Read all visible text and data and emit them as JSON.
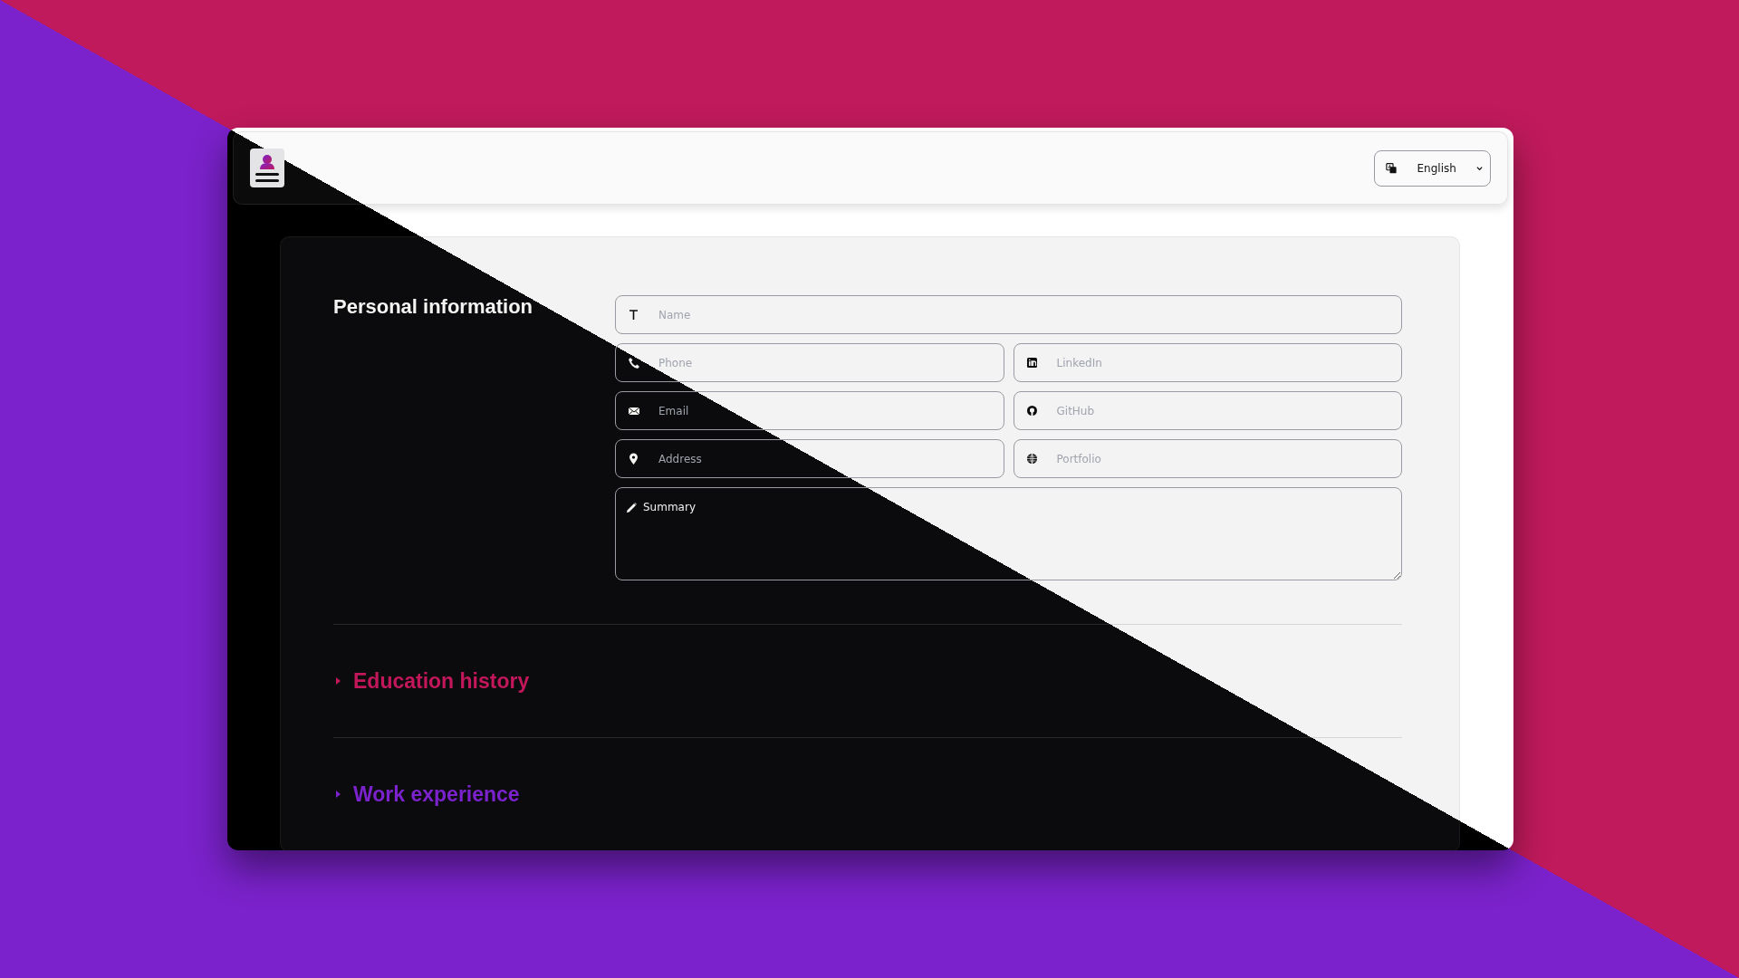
{
  "header": {
    "language": {
      "value": "English"
    }
  },
  "personal": {
    "title": "Personal information",
    "fields": [
      {
        "kind": "wide",
        "placeholder": "Name"
      },
      {
        "kind": "half",
        "placeholder": "Phone"
      },
      {
        "kind": "half",
        "placeholder": "LinkedIn"
      },
      {
        "kind": "half",
        "placeholder": "Email"
      },
      {
        "kind": "half",
        "placeholder": "GitHub"
      },
      {
        "kind": "half",
        "placeholder": "Address"
      },
      {
        "kind": "half",
        "placeholder": "Portfolio"
      },
      {
        "kind": "textarea",
        "placeholder": "Summary"
      }
    ]
  },
  "sections": [
    {
      "title": "Education history",
      "expanded": false,
      "color": "#c2185b"
    },
    {
      "title": "Work experience",
      "expanded": false,
      "color": "#7b22cc"
    }
  ]
}
